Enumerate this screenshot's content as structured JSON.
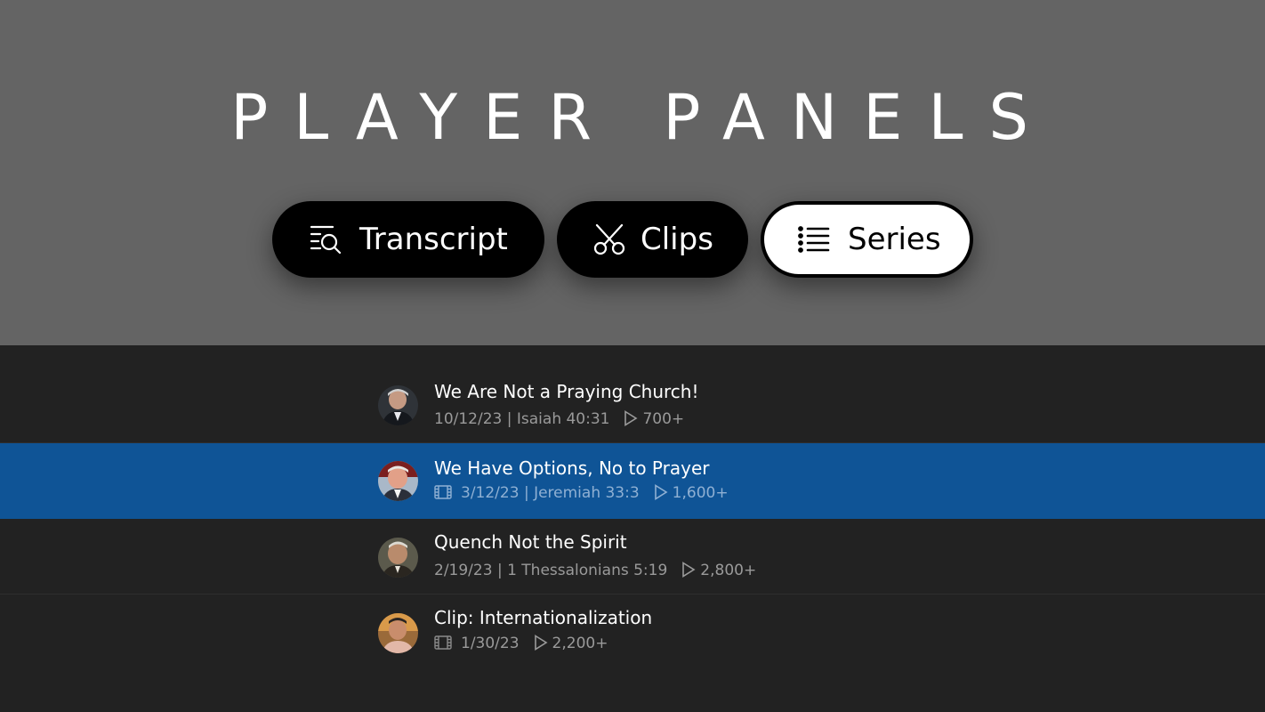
{
  "header": {
    "title": "PLAYER PANELS"
  },
  "tabs": [
    {
      "label": "Transcript",
      "icon": "transcript-search-icon",
      "active": false
    },
    {
      "label": "Clips",
      "icon": "scissors-icon",
      "active": false
    },
    {
      "label": "Series",
      "icon": "list-icon",
      "active": true
    }
  ],
  "series": {
    "items": [
      {
        "title": "We Are Not a Praying Church!",
        "date_ref": "10/12/23 | Isaiah 40:31",
        "views": "700+",
        "has_video": false,
        "active": false
      },
      {
        "title": "We Have Options, No to Prayer",
        "date_ref": "3/12/23 | Jeremiah 33:3",
        "views": "1,600+",
        "has_video": true,
        "active": true
      },
      {
        "title": "Quench Not the Spirit",
        "date_ref": "2/19/23 | 1 Thessalonians 5:19",
        "views": "2,800+",
        "has_video": false,
        "active": false
      },
      {
        "title": "Clip: Internationalization",
        "date_ref": "1/30/23",
        "views": "2,200+",
        "has_video": true,
        "active": false
      }
    ]
  },
  "colors": {
    "header_bg": "#646464",
    "list_bg": "#222222",
    "active_row": "#0f5496",
    "tab_bg": "#000000",
    "tab_active_bg": "#ffffff"
  }
}
